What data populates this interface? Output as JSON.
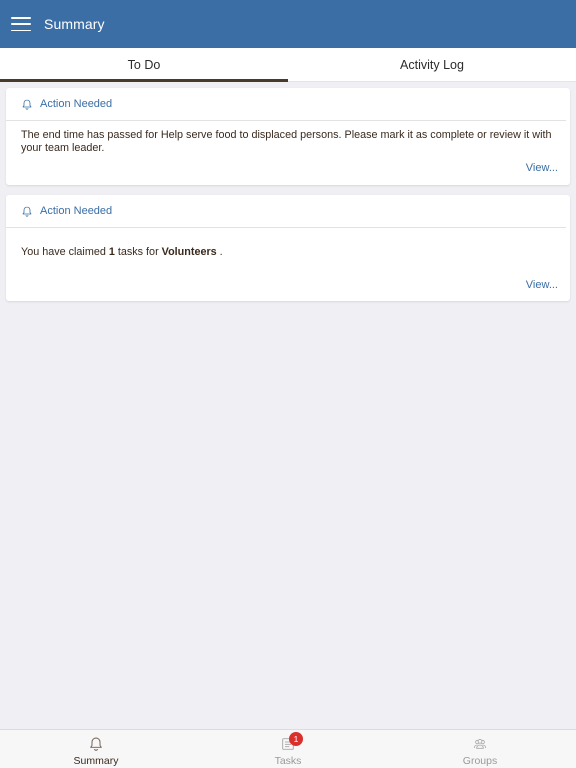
{
  "header": {
    "title": "Summary",
    "menu_icon": "hamburger-menu-icon"
  },
  "tabs": [
    {
      "label": "To Do",
      "active": true
    },
    {
      "label": "Activity Log",
      "active": false
    }
  ],
  "cards": [
    {
      "icon": "bell-icon",
      "heading": "Action Needed",
      "message": "The end time has passed for Help serve food to displaced persons. Please mark it as complete or review it with your team leader.",
      "link": "View..."
    },
    {
      "icon": "bell-icon",
      "heading": "Action Needed",
      "message_prefix": "You have claimed ",
      "claimed_count": "1",
      "message_middle": " tasks for ",
      "group_name": "Volunteers",
      "message_suffix": " .",
      "link": "View..."
    }
  ],
  "bottom_nav": [
    {
      "label": "Summary",
      "icon": "bell-icon",
      "active": true
    },
    {
      "label": "Tasks",
      "icon": "tasks-list-icon",
      "badge": "1",
      "active": false
    },
    {
      "label": "Groups",
      "icon": "groups-icon",
      "active": false
    }
  ],
  "colors": {
    "header_bg": "#3a6ea5",
    "accent": "#3a6ea5",
    "tab_indicator": "#4a3a2c",
    "badge": "#d9302c",
    "background": "#efeff4"
  }
}
